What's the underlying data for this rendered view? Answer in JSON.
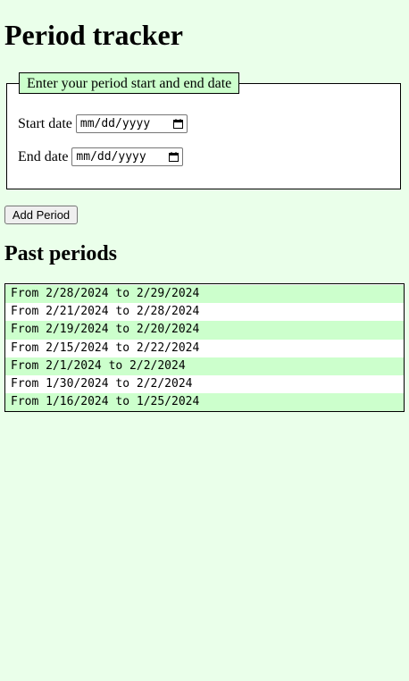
{
  "page": {
    "title": "Period tracker"
  },
  "form": {
    "legend": "Enter your period start and end date",
    "start_label": "Start date",
    "start_value": "mm/dd/yyyy",
    "end_label": "End date",
    "end_value": "mm/dd/yyyy",
    "calendar_icon": "calendar-icon"
  },
  "actions": {
    "add_label": "Add Period"
  },
  "past": {
    "title": "Past periods",
    "rows": [
      "From 2/28/2024 to 2/29/2024",
      "From 2/21/2024 to 2/28/2024",
      "From 2/19/2024 to 2/20/2024",
      "From 2/15/2024 to 2/22/2024",
      "From 2/1/2024 to 2/2/2024",
      "From 1/30/2024 to 2/2/2024",
      "From 1/16/2024 to 1/25/2024"
    ]
  },
  "colors": {
    "page_background": "#eaffea",
    "highlight": "#ccffcc"
  }
}
